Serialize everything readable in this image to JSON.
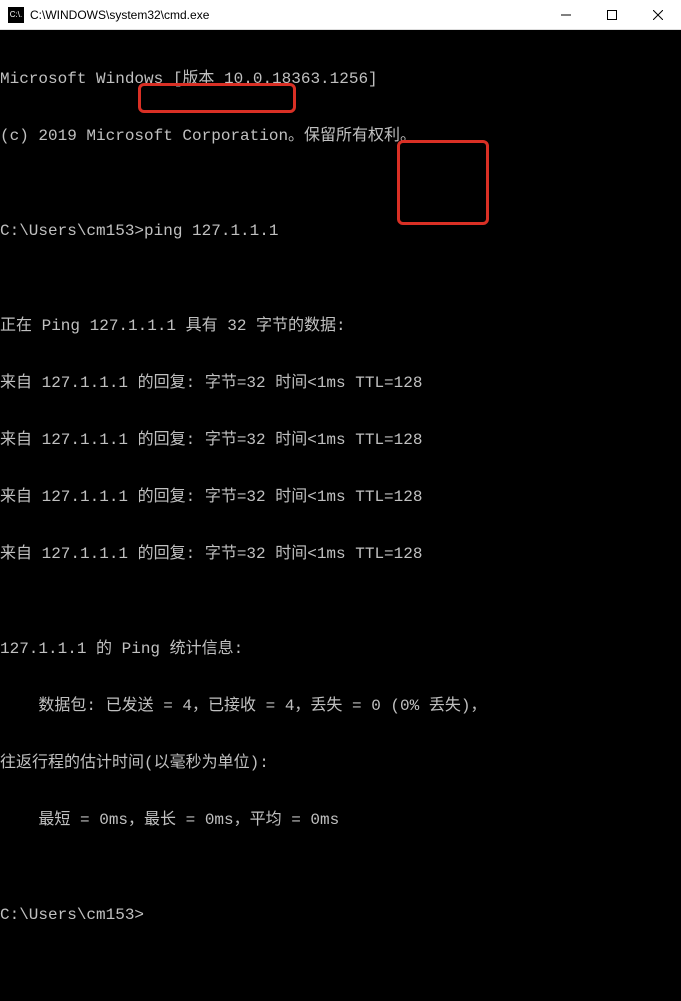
{
  "window": {
    "title": "C:\\WINDOWS\\system32\\cmd.exe",
    "icon_label": "C:\\."
  },
  "terminal": {
    "lines": [
      "Microsoft Windows [版本 10.0.18363.1256]",
      "(c) 2019 Microsoft Corporation。保留所有权利。",
      "",
      "C:\\Users\\cm153>ping 127.1.1.1",
      "",
      "正在 Ping 127.1.1.1 具有 32 字节的数据:",
      "来自 127.1.1.1 的回复: 字节=32 时间<1ms TTL=128",
      "来自 127.1.1.1 的回复: 字节=32 时间<1ms TTL=128",
      "来自 127.1.1.1 的回复: 字节=32 时间<1ms TTL=128",
      "来自 127.1.1.1 的回复: 字节=32 时间<1ms TTL=128",
      "",
      "127.1.1.1 的 Ping 统计信息:",
      "    数据包: 已发送 = 4，已接收 = 4，丢失 = 0 (0% 丢失)，",
      "往返行程的估计时间(以毫秒为单位):",
      "    最短 = 0ms，最长 = 0ms，平均 = 0ms",
      "",
      "C:\\Users\\cm153>"
    ]
  },
  "highlights": {
    "command": "ping 127.1.1.1",
    "ttl_values": [
      "TTL=128",
      "TTL=128",
      "TTL=128",
      "TTL=128"
    ]
  }
}
